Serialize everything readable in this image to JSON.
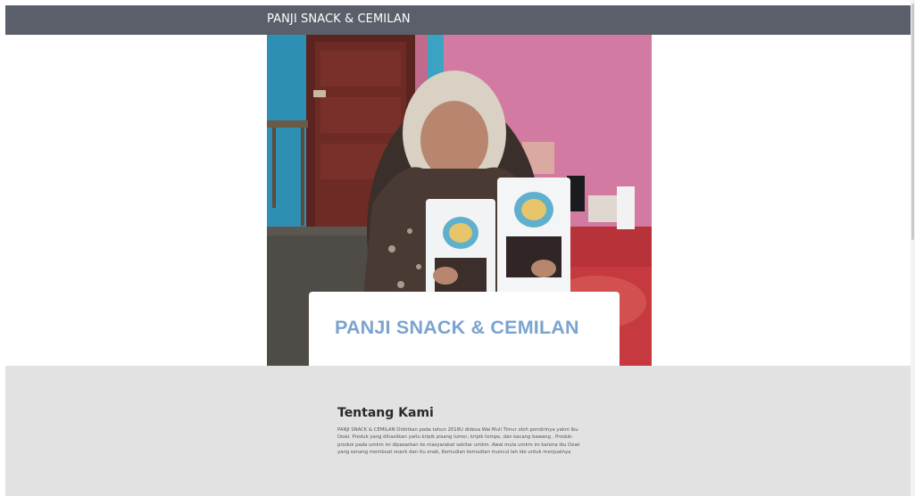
{
  "navbar": {
    "brand": "PANJI SNACK & CEMILAN"
  },
  "hero": {
    "image_alt": "Ibu Dewi holding two packages of snacks",
    "card_title": "PANJI SNACK & CEMILAN"
  },
  "about": {
    "heading": "Tentang Kami",
    "body": "PANJI SNACK & CEMILAN Didirikan pada tahun 2018U didesa Wai Muli Timur oleh pendirinya yakni ibu Dewi. Produk yang dihasilkan yaitu kripik pisang lumer, kripik tempe, dan kacang bawang . Produk-produk pada umkm ini dipasarkan ke masyarakat sekitar umkm. Awal mula umkm ini karena ibu Dewi yang senang membuat snack dan itu enak, Kemudian kemudian muncul lah ide untuk menjualnya"
  },
  "colors": {
    "navbar_bg": "#5b5f69",
    "card_title": "#7ba3cf",
    "about_bg": "#e2e2e2"
  }
}
